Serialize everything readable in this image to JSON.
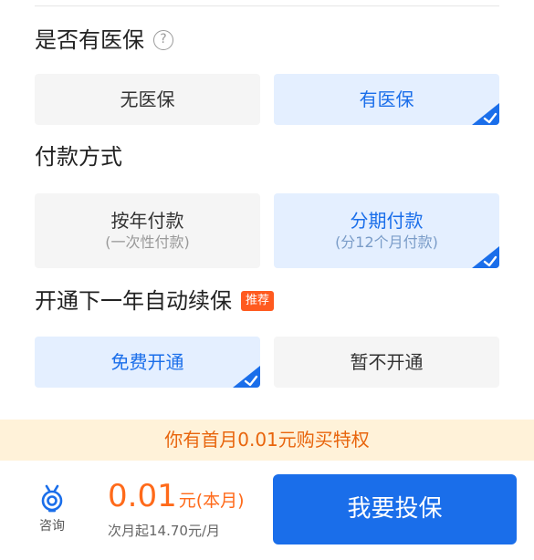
{
  "insurance_section": {
    "title": "是否有医保",
    "help_icon": "question-circle-icon",
    "options": [
      {
        "label": "无医保",
        "selected": false
      },
      {
        "label": "有医保",
        "selected": true
      }
    ]
  },
  "payment_section": {
    "title": "付款方式",
    "options": [
      {
        "label": "按年付款",
        "sub": "(一次性付款)",
        "selected": false
      },
      {
        "label": "分期付款",
        "sub": "(分12个月付款)",
        "selected": true
      }
    ]
  },
  "renewal_section": {
    "title": "开通下一年自动续保",
    "badge": "推荐",
    "options": [
      {
        "label": "免费开通",
        "selected": true
      },
      {
        "label": "暂不开通",
        "selected": false
      }
    ]
  },
  "promo_banner": "你有首月0.01元购买特权",
  "bottom_bar": {
    "consult_label": "咨询",
    "consult_icon": "consult-headset-icon",
    "price_value": "0.01",
    "price_unit": "元(本月)",
    "price_sub": "次月起14.70元/月",
    "buy_label": "我要投保"
  },
  "colors": {
    "accent_blue": "#1a6eea",
    "selected_bg": "#e4efff",
    "price_orange": "#ff6a1a",
    "badge_orange": "#ff5a1f",
    "banner_bg": "#fff2d9",
    "banner_text": "#e8650d"
  }
}
